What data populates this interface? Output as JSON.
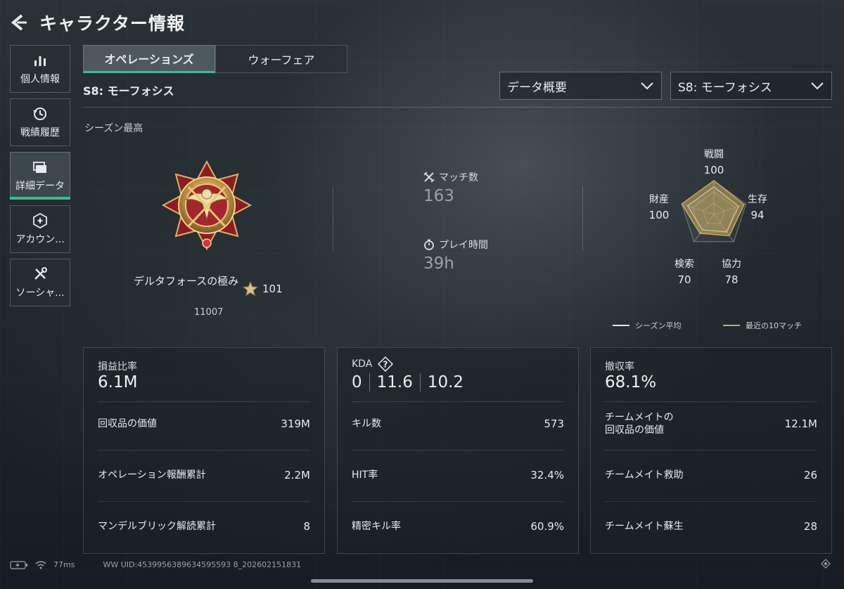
{
  "header": {
    "title": "キャラクター情報"
  },
  "sidebar": {
    "items": [
      {
        "label": "個人情報",
        "active": false
      },
      {
        "label": "戦績履歴",
        "active": false
      },
      {
        "label": "詳細データ",
        "active": true
      },
      {
        "label": "アカウン...",
        "active": false
      },
      {
        "label": "ソーシャ...",
        "active": false
      }
    ]
  },
  "tabs": {
    "operations": "オペレーションズ",
    "warfare": "ウォーフェア"
  },
  "season_label": "S8: モーフォシス",
  "dropdowns": {
    "data_type": "データ概要",
    "season": "S8: モーフォシス"
  },
  "section_label": "シーズン最高",
  "rank": {
    "name": "デルタフォースの極み",
    "stars": "101",
    "points": "11007"
  },
  "stats": {
    "matches_label": "マッチ数",
    "matches_value": "163",
    "playtime_label": "プレイ時間",
    "playtime_value": "39h"
  },
  "radar": {
    "labels": {
      "combat": "戦闘",
      "survival": "生存",
      "coop": "協力",
      "search": "検索",
      "assets": "財産"
    },
    "values": {
      "combat": "100",
      "survival": "94",
      "coop": "78",
      "search": "70",
      "assets": "100"
    },
    "levels": {
      "combat": 1.0,
      "survival": 0.94,
      "coop": 0.78,
      "search": 0.7,
      "assets": 1.0
    },
    "legend": {
      "season_avg": "シーズン平均",
      "recent10": "最近の10マッチ"
    },
    "colors": {
      "season_avg": "#e8ebec",
      "recent10": "#c9a75a"
    }
  },
  "cards": {
    "profit": {
      "head": "損益比率",
      "big": "6.1M",
      "rows": [
        {
          "k": "回収品の価値",
          "v": "319M"
        },
        {
          "k": "オペレーション報酬累計",
          "v": "2.2M"
        },
        {
          "k": "マンデルブリック解読累計",
          "v": "8"
        }
      ]
    },
    "kda": {
      "head": "KDA",
      "k": "0",
      "d": "11.6",
      "a": "10.2",
      "rows": [
        {
          "k": "キル数",
          "v": "573"
        },
        {
          "k": "HIT率",
          "v": "32.4%"
        },
        {
          "k": "精密キル率",
          "v": "60.9%"
        }
      ]
    },
    "extract": {
      "head": "撤収率",
      "big": "68.1%",
      "rows": [
        {
          "k": "チームメイトの\n回収品の価値",
          "v": "12.1M"
        },
        {
          "k": "チームメイト救助",
          "v": "26"
        },
        {
          "k": "チームメイト蘇生",
          "v": "28"
        }
      ]
    }
  },
  "footer": {
    "ping": "77ms",
    "uid": "WW UID:4539956389634595593 8_202602151831"
  },
  "colors": {
    "accent": "#2ec48a",
    "gold": "#c9a75a"
  }
}
